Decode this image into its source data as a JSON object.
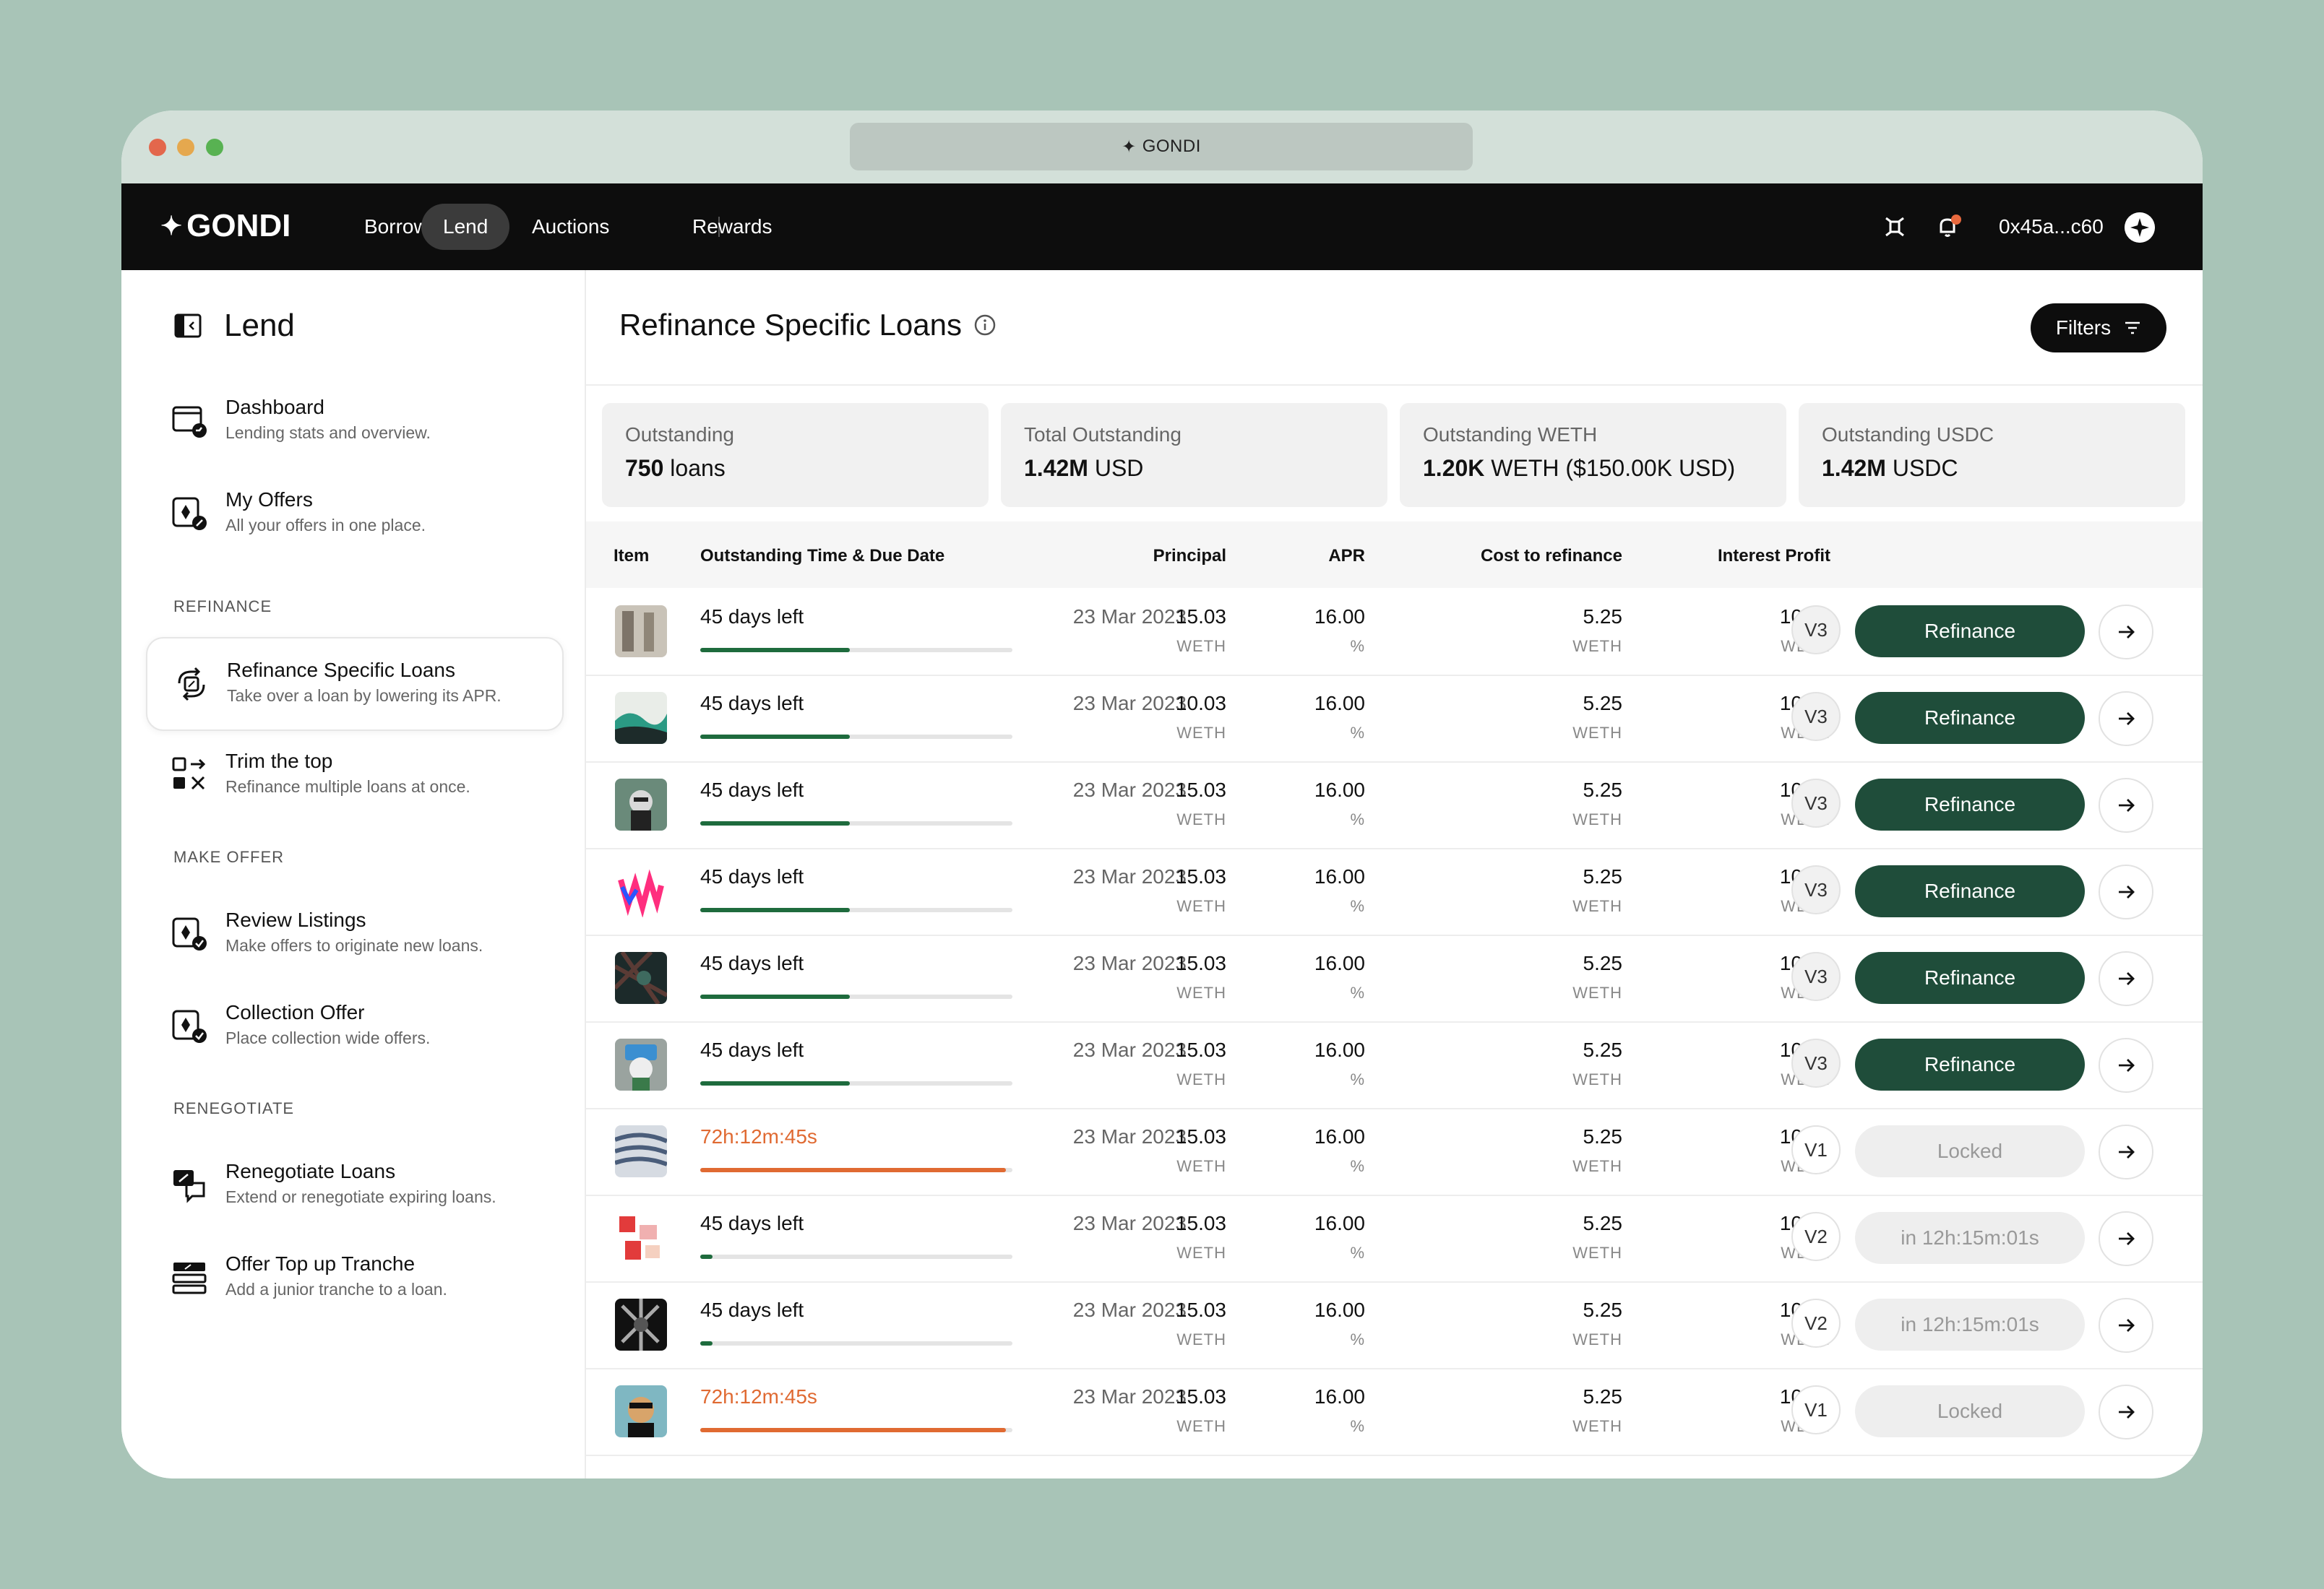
{
  "browser": {
    "url_title": "GONDI"
  },
  "nav": {
    "logo": "GONDI",
    "links": [
      "Borrow",
      "Lend",
      "Auctions",
      "Rewards"
    ],
    "active": "Lend",
    "wallet": "0x45a...c60"
  },
  "sidebar": {
    "title": "Lend",
    "items": [
      {
        "title": "Dashboard",
        "subtitle": "Lending stats and overview."
      },
      {
        "title": "My Offers",
        "subtitle": "All your offers in one place."
      },
      {
        "title": "Refinance Specific Loans",
        "subtitle": "Take over a loan by lowering its APR."
      },
      {
        "title": "Trim the top",
        "subtitle": "Refinance multiple loans at once."
      },
      {
        "title": "Review Listings",
        "subtitle": "Make offers to originate new loans."
      },
      {
        "title": "Collection Offer",
        "subtitle": "Place collection wide offers."
      },
      {
        "title": "Renegotiate Loans",
        "subtitle": "Extend or renegotiate expiring loans."
      },
      {
        "title": "Offer Top up Tranche",
        "subtitle": "Add a junior tranche to a loan."
      }
    ],
    "sections": [
      "REFINANCE",
      "MAKE OFFER",
      "RENEGOTIATE"
    ]
  },
  "main": {
    "title": "Refinance Specific Loans",
    "filters_label": "Filters",
    "stats": [
      {
        "label": "Outstanding",
        "value_bold": "750",
        "value_rest": " loans"
      },
      {
        "label": "Total Outstanding",
        "value_bold": "1.42M",
        "value_rest": " USD"
      },
      {
        "label": "Outstanding WETH",
        "value_bold": "1.20K",
        "value_rest": " WETH ($150.00K USD)"
      },
      {
        "label": "Outstanding USDC",
        "value_bold": "1.42M",
        "value_rest": " USDC"
      }
    ],
    "columns": [
      "Item",
      "Outstanding Time & Due Date",
      "Principal",
      "APR",
      "Cost to refinance",
      "Interest Profit"
    ],
    "units": {
      "weth": "WETH",
      "pct": "%"
    }
  },
  "rows": [
    {
      "time": "45 days left",
      "warn": false,
      "due": "23 Mar 2023",
      "progress": 0.48,
      "principal": "15.03",
      "apr": "16.00",
      "cost": "5.25",
      "profit": "10.50",
      "version": "V3",
      "action": "Refinance",
      "action_type": "primary"
    },
    {
      "time": "45 days left",
      "warn": false,
      "due": "23 Mar 2023",
      "progress": 0.48,
      "principal": "10.03",
      "apr": "16.00",
      "cost": "5.25",
      "profit": "10.50",
      "version": "V3",
      "action": "Refinance",
      "action_type": "primary"
    },
    {
      "time": "45 days left",
      "warn": false,
      "due": "23 Mar 2023",
      "progress": 0.48,
      "principal": "15.03",
      "apr": "16.00",
      "cost": "5.25",
      "profit": "10.50",
      "version": "V3",
      "action": "Refinance",
      "action_type": "primary"
    },
    {
      "time": "45 days left",
      "warn": false,
      "due": "23 Mar 2023",
      "progress": 0.48,
      "principal": "15.03",
      "apr": "16.00",
      "cost": "5.25",
      "profit": "10.50",
      "version": "V3",
      "action": "Refinance",
      "action_type": "primary"
    },
    {
      "time": "45 days left",
      "warn": false,
      "due": "23 Mar 2023",
      "progress": 0.48,
      "principal": "15.03",
      "apr": "16.00",
      "cost": "5.25",
      "profit": "10.50",
      "version": "V3",
      "action": "Refinance",
      "action_type": "primary"
    },
    {
      "time": "45 days left",
      "warn": false,
      "due": "23 Mar 2023",
      "progress": 0.48,
      "principal": "15.03",
      "apr": "16.00",
      "cost": "5.25",
      "profit": "10.50",
      "version": "V3",
      "action": "Refinance",
      "action_type": "primary"
    },
    {
      "time": "72h:12m:45s",
      "warn": true,
      "due": "23 Mar 2023",
      "progress": 0.98,
      "principal": "15.03",
      "apr": "16.00",
      "cost": "5.25",
      "profit": "10.50",
      "version": "V1",
      "action": "Locked",
      "action_type": "disabled"
    },
    {
      "time": "45 days left",
      "warn": false,
      "due": "23 Mar 2023",
      "progress": 0.04,
      "principal": "15.03",
      "apr": "16.00",
      "cost": "5.25",
      "profit": "10.50",
      "version": "V2",
      "action": "in 12h:15m:01s",
      "action_type": "disabled"
    },
    {
      "time": "45 days left",
      "warn": false,
      "due": "23 Mar 2023",
      "progress": 0.04,
      "principal": "15.03",
      "apr": "16.00",
      "cost": "5.25",
      "profit": "10.50",
      "version": "V2",
      "action": "in 12h:15m:01s",
      "action_type": "disabled"
    },
    {
      "time": "72h:12m:45s",
      "warn": true,
      "due": "23 Mar 2023",
      "progress": 0.98,
      "principal": "15.03",
      "apr": "16.00",
      "cost": "5.25",
      "profit": "10.50",
      "version": "V1",
      "action": "Locked",
      "action_type": "disabled"
    }
  ],
  "colors": {
    "accent": "#1f4d3a",
    "warning": "#e06a32",
    "progress": "#1e6b3d",
    "background": "#a8c4b7"
  }
}
